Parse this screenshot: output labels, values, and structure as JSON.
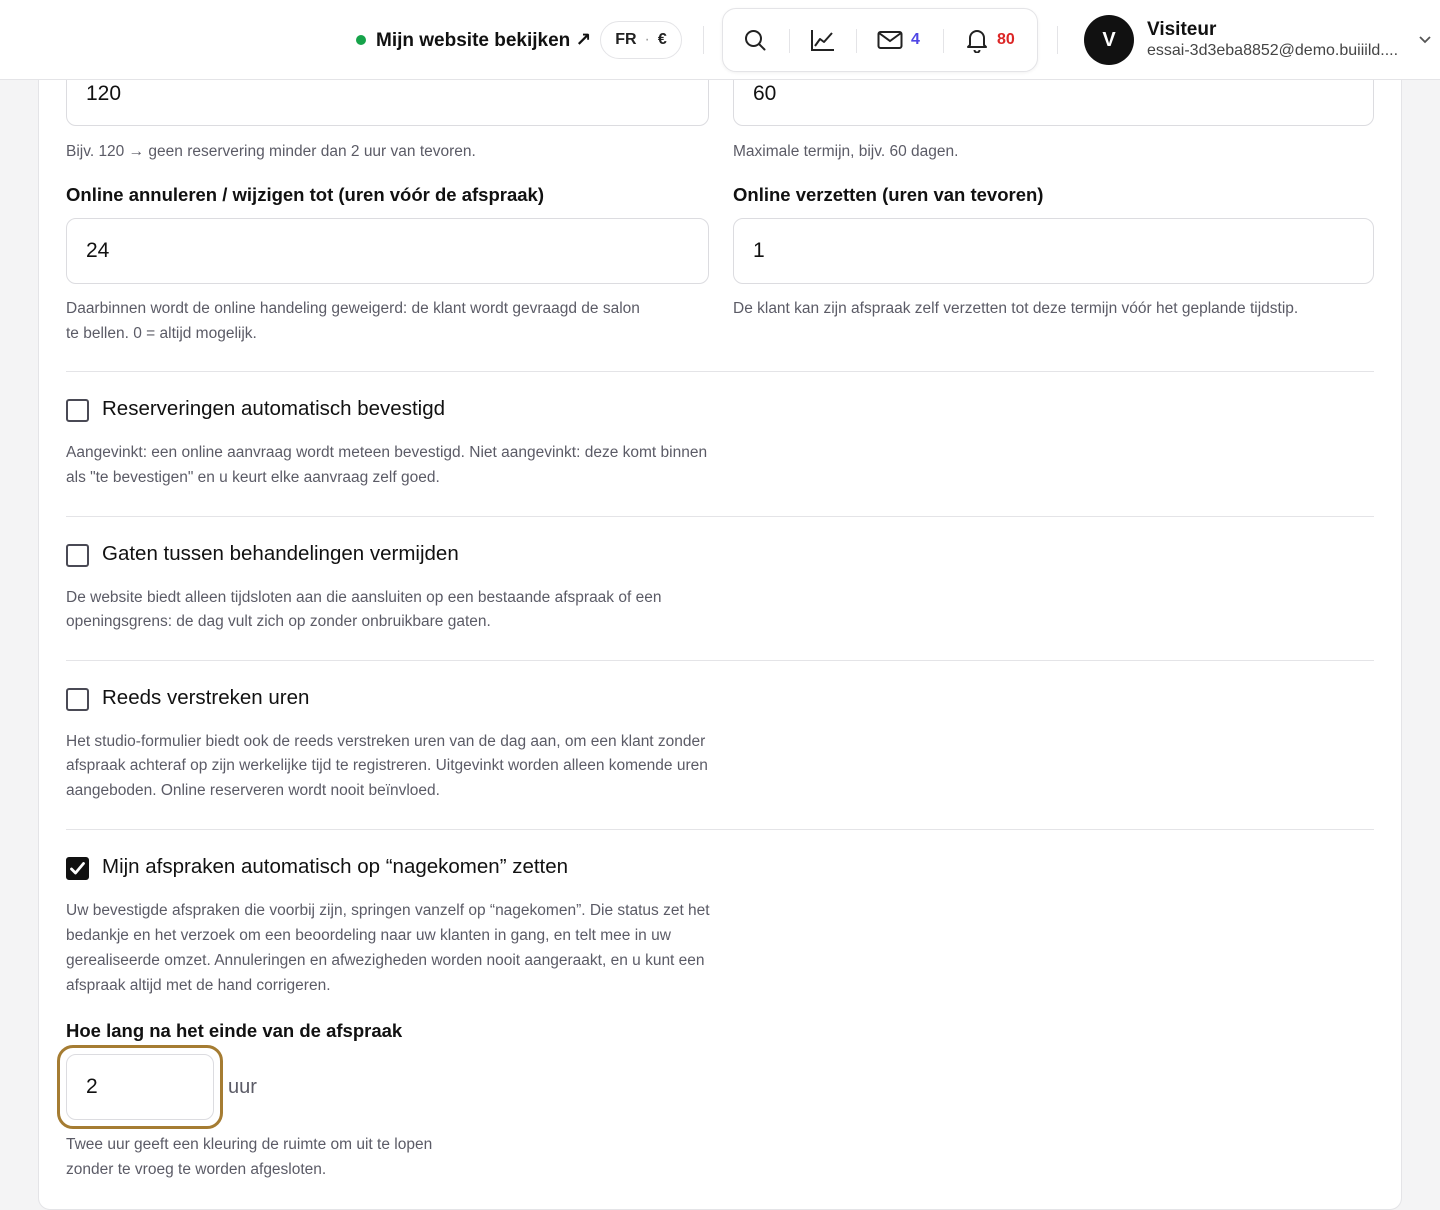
{
  "header": {
    "site_link_label": "Mijn website bekijken ↗",
    "lang": "FR",
    "lang_sep": "·",
    "currency": "€",
    "messages_count": "4",
    "notifications_count": "80",
    "user_initial": "V",
    "user_name": "Visiteur",
    "user_email": "essai-3d3eba8852@demo.buiiild...."
  },
  "form": {
    "min_advance_value": "120",
    "min_advance_help": "Bijv. 120 → geen reservering minder dan 2 uur van tevoren.",
    "max_advance_value": "60",
    "max_advance_help": "Maximale termijn, bijv. 60 dagen.",
    "cancel_label": "Online annuleren / wijzigen tot (uren vóór de afspraak)",
    "cancel_value": "24",
    "cancel_help_1": "Daarbinnen wordt de online handeling geweigerd: de klant wordt gevraagd de salon",
    "cancel_help_2": "te bellen. 0 = altijd mogelijk.",
    "reschedule_label": "Online verzetten (uren van tevoren)",
    "reschedule_value": "1",
    "reschedule_help": "De klant kan zijn afspraak zelf verzetten tot deze termijn vóór het geplande tijdstip.",
    "auto_confirm_label": "Reserveringen automatisch bevestigd",
    "auto_confirm_help_1": "Aangevinkt: een online aanvraag wordt meteen bevestigd. Niet aangevinkt: deze komt binnen",
    "auto_confirm_help_2": "als \"te bevestigen\" en u keurt elke aanvraag zelf goed.",
    "gaps_label": "Gaten tussen behandelingen vermijden",
    "gaps_help_1": "De website biedt alleen tijdsloten aan die aansluiten op een bestaande afspraak of een",
    "gaps_help_2": "openingsgrens: de dag vult zich op zonder onbruikbare gaten.",
    "past_hours_label": "Reeds verstreken uren",
    "past_hours_help_1": "Het studio-formulier biedt ook de reeds verstreken uren van de dag aan, om een klant zonder",
    "past_hours_help_2": "afspraak achteraf op zijn werkelijke tijd te registreren. Uitgevinkt worden alleen komende uren",
    "past_hours_help_3": "aangeboden. Online reserveren wordt nooit beïnvloed.",
    "auto_complete_label": "Mijn afspraken automatisch op “nagekomen” zetten",
    "auto_complete_help_1": "Uw bevestigde afspraken die voorbij zijn, springen vanzelf op “nagekomen”. Die status zet het",
    "auto_complete_help_2": "bedankje en het verzoek om een beoordeling naar uw klanten in gang, en telt mee in uw",
    "auto_complete_help_3": "gerealiseerde omzet. Annuleringen en afwezigheden worden nooit aangeraakt, en u kunt een",
    "auto_complete_help_4": "afspraak altijd met de hand corrigeren.",
    "delay_label": "Hoe lang na het einde van de afspraak",
    "delay_value": "2",
    "delay_unit": "uur",
    "delay_help_1": "Twee uur geeft een kleuring de ruimte om uit te lopen",
    "delay_help_2": "zonder te vroeg te worden afgesloten."
  },
  "checkboxes": {
    "auto_confirm": false,
    "gaps": false,
    "past_hours": false,
    "auto_complete": true
  },
  "colors": {
    "accent_focus": "#a57c32",
    "status_online": "#16a34a",
    "messages_badge": "#4f46e5",
    "notifications_badge": "#dc2626"
  },
  "icons": [
    "search-icon",
    "chart-icon",
    "mail-icon",
    "bell-icon",
    "chevron-down-icon",
    "check-icon"
  ]
}
